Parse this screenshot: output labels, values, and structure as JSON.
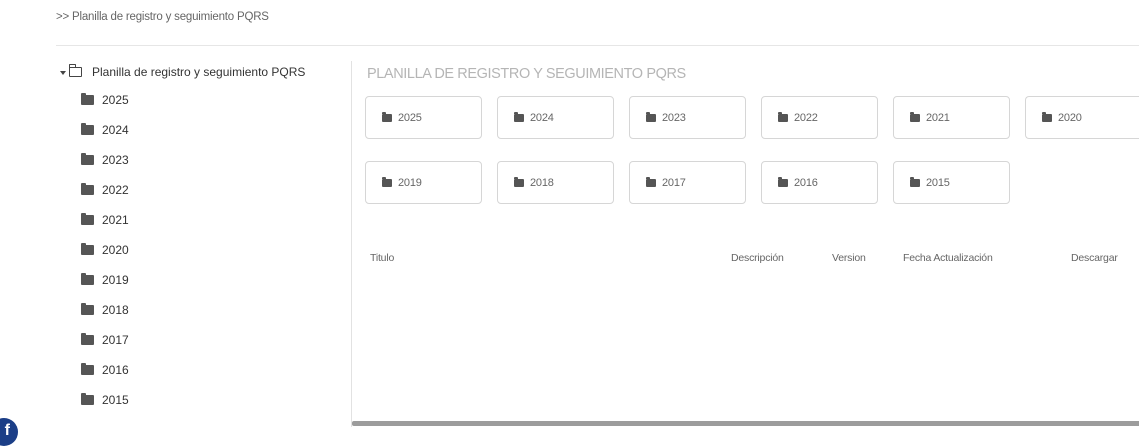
{
  "breadcrumb": ">> Planilla de registro y seguimiento PQRS",
  "tree": {
    "root_label": "Planilla de registro y seguimiento PQRS",
    "items": [
      "2025",
      "2024",
      "2023",
      "2022",
      "2021",
      "2020",
      "2019",
      "2018",
      "2017",
      "2016",
      "2015"
    ]
  },
  "content": {
    "title": "PLANILLA DE REGISTRO Y SEGUIMIENTO PQRS",
    "folder_buttons_row1": [
      "2025",
      "2024",
      "2023",
      "2022",
      "2021",
      "2020"
    ],
    "folder_buttons_row2": [
      "2019",
      "2018",
      "2017",
      "2016",
      "2015"
    ],
    "table_headers": {
      "titulo": "Titulo",
      "descripcion": "Descripción",
      "version": "Version",
      "fecha": "Fecha Actualización",
      "descargar": "Descargar"
    }
  },
  "social": {
    "facebook_glyph": "f"
  },
  "icons": {
    "tree_folder": "folder-icon",
    "root_folder": "folder-open-icon",
    "expand": "caret-down-icon"
  }
}
